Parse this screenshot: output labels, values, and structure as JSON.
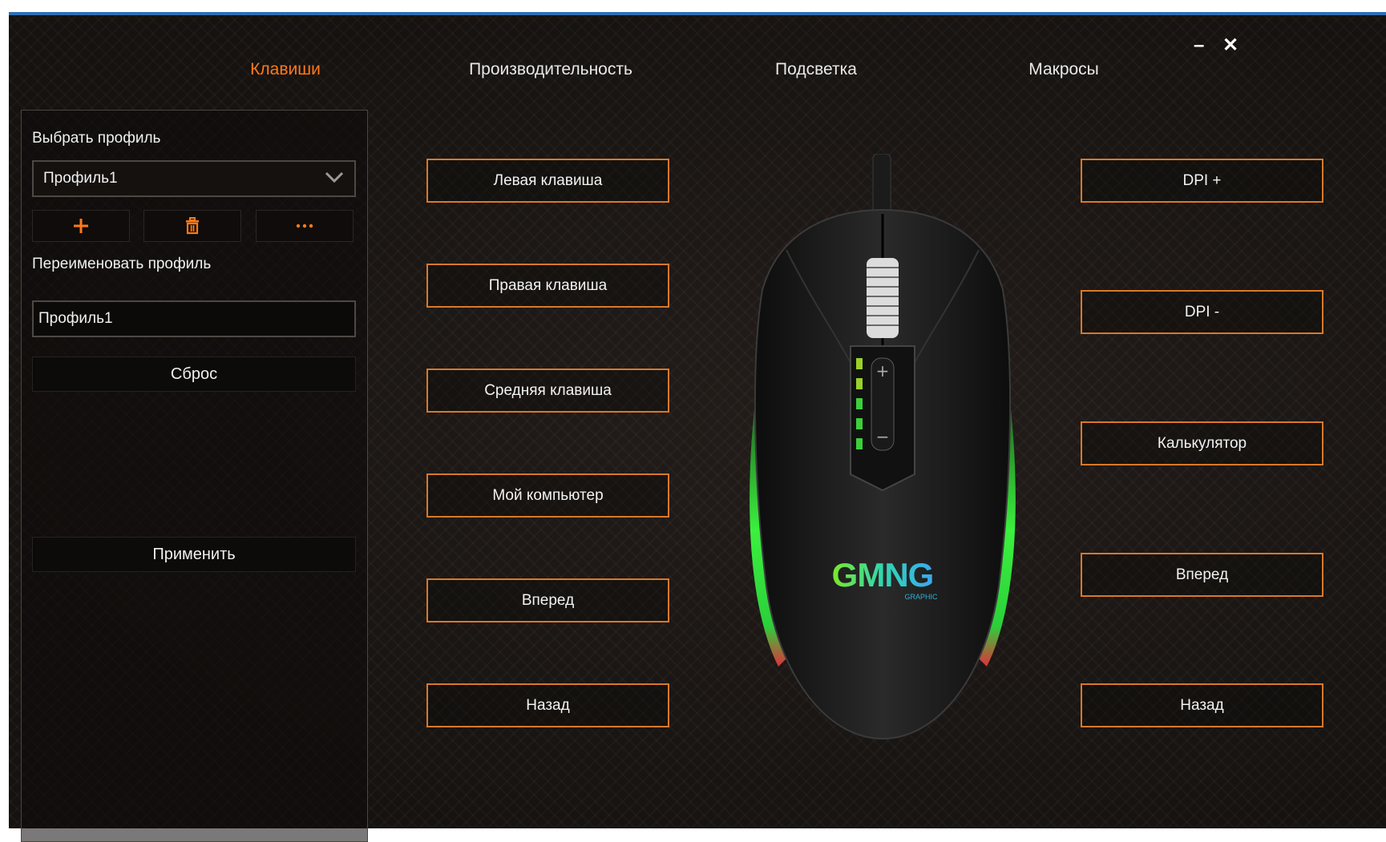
{
  "tabs": [
    {
      "label": "Клавиши",
      "active": true
    },
    {
      "label": "Производительность",
      "active": false
    },
    {
      "label": "Подсветка",
      "active": false
    },
    {
      "label": "Макросы",
      "active": false
    }
  ],
  "window": {
    "minimize_icon": "minimize-icon",
    "close_icon": "close-icon"
  },
  "sidebar": {
    "select_label": "Выбрать профиль",
    "selected_profile": "Профиль1",
    "rename_label": "Переименовать профиль",
    "rename_value": "Профиль1",
    "reset_label": "Сброс",
    "apply_label": "Применить",
    "icons": [
      "plus-icon",
      "trash-icon",
      "more-icon"
    ]
  },
  "left_buttons": [
    "Левая клавиша",
    "Правая клавиша",
    "Средняя клавиша",
    "Мой компьютер",
    "Вперед",
    "Назад"
  ],
  "right_buttons": [
    "DPI +",
    "DPI -",
    "Калькулятор",
    "Вперед",
    "Назад"
  ],
  "mouse": {
    "logo": "GMNG",
    "logo_sub": "GRAPHIC"
  },
  "colors": {
    "accent": "#ff7a1a",
    "button_border": "#d9782a",
    "rgb_green": "#35e43a",
    "rgb_red": "#e0303a"
  }
}
